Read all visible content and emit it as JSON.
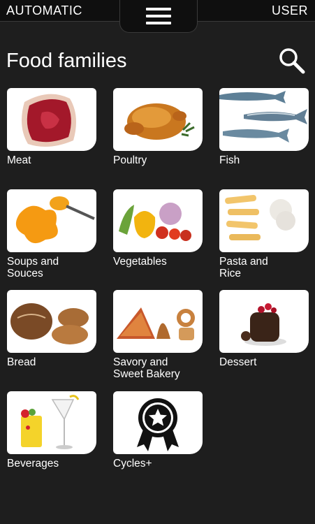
{
  "header": {
    "mode": "AUTOMATIC",
    "user": "USER",
    "menu_icon": "hamburger-menu-icon"
  },
  "page": {
    "title": "Food families",
    "search_icon": "search-icon"
  },
  "families": [
    {
      "label": "Meat"
    },
    {
      "label": "Poultry"
    },
    {
      "label": "Fish"
    },
    {
      "label": "Soups and\nSouces"
    },
    {
      "label": "Vegetables"
    },
    {
      "label": "Pasta and\nRice"
    },
    {
      "label": "Bread"
    },
    {
      "label": "Savory and\nSweet Bakery"
    },
    {
      "label": "Dessert"
    },
    {
      "label": "Beverages"
    },
    {
      "label": "Cycles+"
    }
  ],
  "colors": {
    "background": "#1e1e1e",
    "topbar": "#0f0f0f",
    "text": "#ffffff",
    "card": "#ffffff"
  }
}
